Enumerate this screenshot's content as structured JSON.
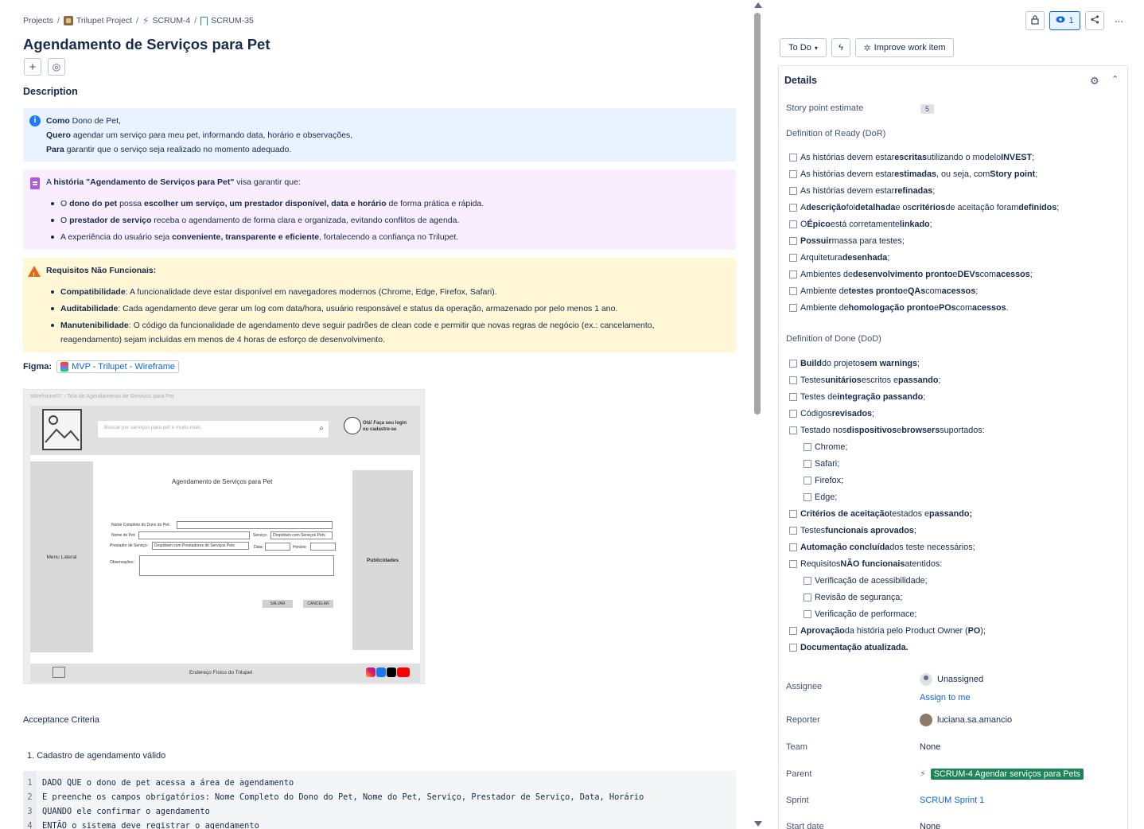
{
  "breadcrumb": {
    "projects": "Projects",
    "project": "Trilupet Project",
    "epic": "SCRUM-4",
    "story": "SCRUM-35"
  },
  "issue": {
    "title": "Agendamento de Serviços para Pet",
    "description_heading": "Description"
  },
  "info_panel": {
    "line1_bold": "Como",
    "line1": " Dono de Pet,",
    "line2_bold": "Quero",
    "line2": " agendar um serviço para meu pet, informando data, horário e observações,",
    "line3_bold": "Para",
    "line3": " garantir que o serviço seja realizado no momento adequado."
  },
  "note_panel": {
    "intro_pre": "A ",
    "intro_bold": "história \"Agendamento de Serviços para Pet\"",
    "intro_post": " visa garantir que:",
    "b1_pre": "O ",
    "b1_bold": "dono do pet",
    "b1_mid": " possa ",
    "b1_bold2": "escolher um serviço, um prestador disponível, data e horário",
    "b1_post": " de forma prática e rápida.",
    "b2_pre": "O ",
    "b2_bold": "prestador de serviço",
    "b2_post": " receba o agendamento de forma clara e organizada, evitando conflitos de agenda.",
    "b3_pre": "A experiência do usuário seja ",
    "b3_bold": "conveniente, transparente e eficiente",
    "b3_post": ", fortalecendo a confiança no Trilupet."
  },
  "warn_panel": {
    "heading": "Requisitos Não Funcionais:",
    "b1_bold": "Compatibilidade",
    "b1": ": A funcionalidade deve estar disponível em navegadores modernos (Chrome, Edge, Firefox, Safari).",
    "b2_bold": "Auditabilidade",
    "b2": ": Cada agendamento deve gerar um log com data/hora, usuário responsável e status da operação, armazenado por pelo menos 1 ano.",
    "b3_bold": "Manutenibilidade",
    "b3_l1": ": O código da funcionalidade de agendamento deve seguir padrões de clean code e permitir que novas regras de negócio (ex.: cancelamento,",
    "b3_l2": "reagendamento) sejam incluídas em menos de 4 horas de esforço de desenvolvimento."
  },
  "figma": {
    "label": "Figma:",
    "link": "MVP - Trilupet - Wireframe"
  },
  "wireframe": {
    "caption": "Wireframe07 - Tela de Agendamento de Serviços para Pet",
    "search_placeholder": "Buscar por serviços para pet e muito mais",
    "login_l1": "Olá! Faça seu login",
    "login_l2": "ou cadastre-se",
    "menu": "Menu Lateral",
    "ads": "Publicidades",
    "form_title": "Agendamento de Serviços para Pet",
    "f_owner": "Nome Completo do Dono do Pet:",
    "f_pet": "Nome do Pet:",
    "f_service": "Serviço:",
    "f_service_val": "Dropdown com Serviços Pets",
    "f_provider": "Prestador de Serviço:",
    "f_provider_val": "Dropdown com Prestadores de  Serviços Pets",
    "f_date": "Data:",
    "f_time": "Horário:",
    "f_obs": "Observações:",
    "save": "SALVAR",
    "cancel": "CANCELAR",
    "footer": "Endereço  Físico do Trilupet"
  },
  "acceptance": {
    "heading": "Acceptance Criteria",
    "item1": "1. Cadastro de agendamento válido",
    "code": [
      {
        "n": "1",
        "t": "DADO QUE o dono de pet acessa a área de agendamento"
      },
      {
        "n": "2",
        "t": "E preenche os campos obrigatórios: Nome Completo do Dono do Pet, Nome do Pet, Serviço, Prestador de Serviço, Data, Horário"
      },
      {
        "n": "3",
        "t": "QUANDO ele confirmar o agendamento"
      },
      {
        "n": "4",
        "t": "ENTÃO o sistema deve registrar o agendamento"
      }
    ]
  },
  "right": {
    "watch_count": "1",
    "status": "To Do",
    "improve": "Improve work item",
    "details_title": "Details",
    "story_point_label": "Story point estimate",
    "story_point_value": "5",
    "dor_label": "Definition of Ready (DoR)",
    "dod_label": "Definition of Done (DoD)",
    "assignee_label": "Assignee",
    "assignee_value": "Unassigned",
    "assign_to_me": "Assign to me",
    "reporter_label": "Reporter",
    "reporter_value": "luciana.sa.amancio",
    "team_label": "Team",
    "team_value": "None",
    "parent_label": "Parent",
    "parent_value": "SCRUM-4 Agendar serviços para Pets",
    "sprint_label": "Sprint",
    "sprint_value": "SCRUM Sprint 1",
    "start_label": "Start date",
    "start_value": "None"
  },
  "dor": [
    {
      "a": "As histórias devem estar ",
      "b": "escritas",
      "c": " utilizando o modelo ",
      "d": "INVEST",
      "e": ";"
    },
    {
      "a": "As histórias devem estar ",
      "b": "estimadas",
      "c": ", ou seja, com ",
      "d": "Story point",
      "e": ";"
    },
    {
      "a": "As histórias devem estar ",
      "b": "refinadas",
      "c": ";",
      "d": "",
      "e": ""
    },
    {
      "a": "A ",
      "b": "descrição",
      "c": " foi ",
      "d": "detalhada",
      "e": " e os ",
      "f": "critérios",
      "g": " de aceitação foram ",
      "h": "definidos",
      "i": ";"
    },
    {
      "a": "O ",
      "b": "Épico",
      "c": " está corretamente ",
      "d": "linkado",
      "e": ";"
    },
    {
      "a": "",
      "b": "Possuir",
      "c": " massa para testes;",
      "d": "",
      "e": ""
    },
    {
      "a": "Arquitetura ",
      "b": "desenhada",
      "c": ";",
      "d": "",
      "e": ""
    },
    {
      "a": "Ambientes de ",
      "b": "desenvolvimento pronto",
      "c": " e ",
      "d": "DEVs",
      "e": " com ",
      "f": "acessos",
      "g": ";"
    },
    {
      "a": "Ambiente de ",
      "b": "testes pronto",
      "c": " e ",
      "d": "QAs",
      "e": " com ",
      "f": "acessos",
      "g": ";"
    },
    {
      "a": "Ambiente de ",
      "b": "homologação pronto",
      "c": " e ",
      "d": "POs",
      "e": " com ",
      "f": "acessos",
      "g": "."
    }
  ],
  "dod": [
    {
      "a": "",
      "b": "Build",
      "c": " do projeto ",
      "d": "sem warnings",
      "e": ";"
    },
    {
      "a": "Testes ",
      "b": "unitários",
      "c": " escritos e ",
      "d": "passando",
      "e": ";"
    },
    {
      "a": "Testes de ",
      "b": "integração passando",
      "c": ";",
      "d": "",
      "e": ""
    },
    {
      "a": "Códigos ",
      "b": "revisados",
      "c": ";",
      "d": "",
      "e": ""
    },
    {
      "a": "Testado nos ",
      "b": "dispositivos",
      "c": " e ",
      "d": "browsers",
      "e": " suportados:"
    },
    {
      "a": "Chrome;",
      "sub": true
    },
    {
      "a": "Safari;",
      "sub": true
    },
    {
      "a": "Firefox;",
      "sub": true
    },
    {
      "a": "Edge;",
      "sub": true
    },
    {
      "a": "",
      "b": "Critérios de aceitação",
      "c": " testados e ",
      "d": "passando;",
      "e": ""
    },
    {
      "a": "Testes ",
      "b": "funcionais aprovados",
      "c": ";",
      "d": "",
      "e": ""
    },
    {
      "a": "",
      "b": "Automação concluída",
      "c": " dos teste necessários;",
      "d": "",
      "e": ""
    },
    {
      "a": "Requisitos ",
      "b": "NÃO funcionais",
      "c": " atentidos:",
      "d": "",
      "e": ""
    },
    {
      "a": "Verificação de acessibilidade;",
      "sub": true
    },
    {
      "a": "Revisão de segurança;",
      "sub": true
    },
    {
      "a": "Verificação de performace;",
      "sub": true
    },
    {
      "a": "",
      "b": "Aprovação",
      "c": " da história pelo Product Owner (",
      "d": "PO",
      "e": ");"
    },
    {
      "a": "",
      "b": "Documentação atualizada.",
      "c": "",
      "d": "",
      "e": ""
    }
  ]
}
